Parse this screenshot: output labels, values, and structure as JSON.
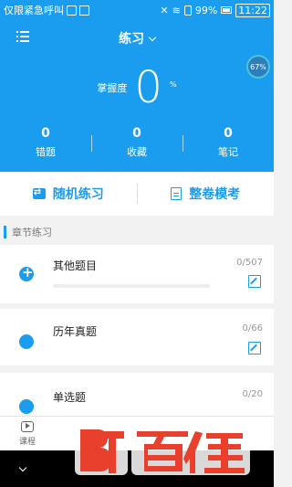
{
  "statusbar": {
    "carrier": "仅限紧急呼叫",
    "battery": "99%",
    "time": "11:22"
  },
  "header": {
    "title": "练习",
    "progress": "67%",
    "mastery_label": "掌握度",
    "mastery_value": "0",
    "mastery_unit": "%"
  },
  "stats": [
    {
      "value": "0",
      "label": "错题"
    },
    {
      "value": "0",
      "label": "收藏"
    },
    {
      "value": "0",
      "label": "笔记"
    }
  ],
  "actions": {
    "random": "随机练习",
    "exam": "整卷模考"
  },
  "section": {
    "title": "章节练习"
  },
  "chapters": [
    {
      "name": "其他题目",
      "count": "0/507",
      "progress": 0
    },
    {
      "name": "历年真题",
      "count": "0/66",
      "progress": 0
    },
    {
      "name": "单选题",
      "count": "0/20",
      "progress": 0
    }
  ],
  "bottomnav": {
    "course": "课程"
  },
  "colors": {
    "primary": "#1a9cef",
    "watermark_red": "#e8402c"
  },
  "watermark": {
    "text": "BT百佳"
  }
}
